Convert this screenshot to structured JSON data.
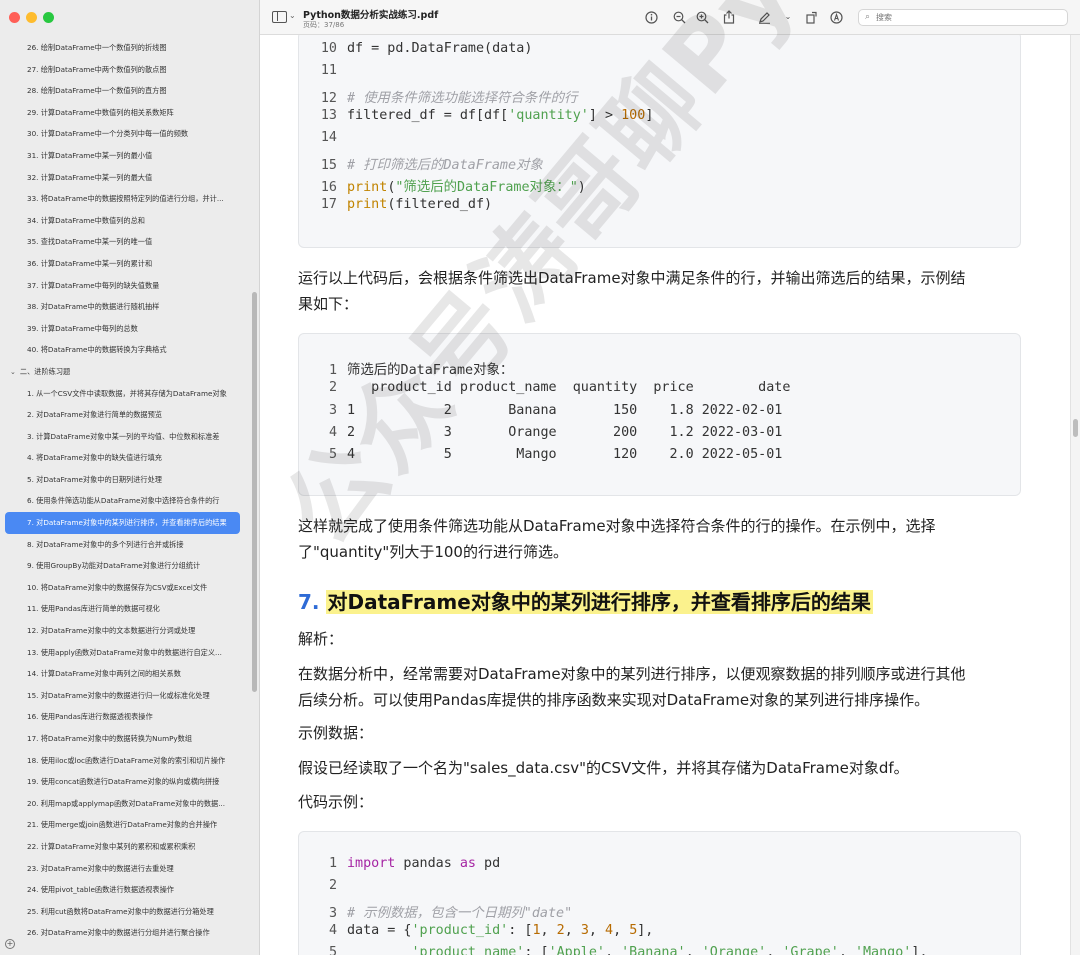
{
  "window": {
    "traffic_colors": [
      "#ff5f57",
      "#febc2e",
      "#28c840"
    ]
  },
  "toolbar": {
    "title": "Python数据分析实战练习.pdf",
    "page_info": "页码：37/86",
    "search_placeholder": "搜索",
    "icons": [
      "info-icon",
      "zoom-out-icon",
      "zoom-in-icon",
      "share-icon",
      "markup-pen-icon",
      "chevron-down-icon",
      "rotate-icon",
      "annotate-icon"
    ]
  },
  "sidebar": {
    "items": [
      {
        "label": "26. 绘制DataFrame中一个数值列的折线图",
        "type": "item"
      },
      {
        "label": "27. 绘制DataFrame中两个数值列的散点图",
        "type": "item"
      },
      {
        "label": "28. 绘制DataFrame中一个数值列的直方图",
        "type": "item"
      },
      {
        "label": "29. 计算DataFrame中数值列的相关系数矩阵",
        "type": "item"
      },
      {
        "label": "30. 计算DataFrame中一个分类列中每一值的频数",
        "type": "item"
      },
      {
        "label": "31. 计算DataFrame中某一列的最小值",
        "type": "item"
      },
      {
        "label": "32. 计算DataFrame中某一列的最大值",
        "type": "item"
      },
      {
        "label": "33. 将DataFrame中的数据按照特定列的值进行分组，并计...",
        "type": "item"
      },
      {
        "label": "34. 计算DataFrame中数值列的总和",
        "type": "item"
      },
      {
        "label": "35. 查找DataFrame中某一列的唯一值",
        "type": "item"
      },
      {
        "label": "36. 计算DataFrame中某一列的累计和",
        "type": "item"
      },
      {
        "label": "37. 计算DataFrame中每列的缺失值数量",
        "type": "item"
      },
      {
        "label": "38. 对DataFrame中的数据进行随机抽样",
        "type": "item"
      },
      {
        "label": "39. 计算DataFrame中每列的总数",
        "type": "item"
      },
      {
        "label": "40. 将DataFrame中的数据转换为字典格式",
        "type": "item"
      },
      {
        "label": "二、进阶练习题",
        "type": "section"
      },
      {
        "label": "1. 从一个CSV文件中读取数据，并将其存储为DataFrame对象",
        "type": "item"
      },
      {
        "label": "2. 对DataFrame对象进行简单的数据预览",
        "type": "item"
      },
      {
        "label": "3. 计算DataFrame对象中某一列的平均值、中位数和标准差",
        "type": "item"
      },
      {
        "label": "4. 将DataFrame对象中的缺失值进行填充",
        "type": "item"
      },
      {
        "label": "5. 对DataFrame对象中的日期列进行处理",
        "type": "item"
      },
      {
        "label": "6. 使用条件筛选功能从DataFrame对象中选择符合条件的行",
        "type": "item"
      },
      {
        "label": "7. 对DataFrame对象中的某列进行排序，并查看排序后的结果",
        "type": "active"
      },
      {
        "label": "8. 对DataFrame对象中的多个列进行合并或拆接",
        "type": "item"
      },
      {
        "label": "9. 使用GroupBy功能对DataFrame对象进行分组统计",
        "type": "item"
      },
      {
        "label": "10. 将DataFrame对象中的数据保存为CSV或Excel文件",
        "type": "item"
      },
      {
        "label": "11. 使用Pandas库进行简单的数据可视化",
        "type": "item"
      },
      {
        "label": "12. 对DataFrame对象中的文本数据进行分词或处理",
        "type": "item"
      },
      {
        "label": "13. 使用apply函数对DataFrame对象中的数据进行自定义...",
        "type": "item"
      },
      {
        "label": "14. 计算DataFrame对象中两列之间的相关系数",
        "type": "item"
      },
      {
        "label": "15. 对DataFrame对象中的数据进行归一化或标准化处理",
        "type": "item"
      },
      {
        "label": "16. 使用Pandas库进行数据透视表操作",
        "type": "item"
      },
      {
        "label": "17. 将DataFrame对象中的数据转换为NumPy数组",
        "type": "item"
      },
      {
        "label": "18. 使用iloc或loc函数进行DataFrame对象的索引和切片操作",
        "type": "item"
      },
      {
        "label": "19. 使用concat函数进行DataFrame对象的纵向或横向拼接",
        "type": "item"
      },
      {
        "label": "20. 利用map或applymap函数对DataFrame对象中的数据...",
        "type": "item"
      },
      {
        "label": "21. 使用merge或join函数进行DataFrame对象的合并操作",
        "type": "item"
      },
      {
        "label": "22. 计算DataFrame对象中某列的累积和或累积乘积",
        "type": "item"
      },
      {
        "label": "23. 对DataFrame对象中的数据进行去重处理",
        "type": "item"
      },
      {
        "label": "24. 使用pivot_table函数进行数据透视表操作",
        "type": "item"
      },
      {
        "label": "25. 利用cut函数将DataFrame对象中的数据进行分箱处理",
        "type": "item"
      },
      {
        "label": "26. 对DataFrame对象中的数据进行分组并进行聚合操作",
        "type": "item"
      }
    ]
  },
  "doc": {
    "code1": [
      {
        "n": "10",
        "html": "df = pd.DataFrame(data)"
      },
      {
        "n": "11",
        "html": ""
      },
      {
        "n": "12",
        "html": "<span class=\"com\"># 使用条件筛选功能选择符合条件的行</span>"
      },
      {
        "n": "13",
        "html": "filtered_df = df[df[<span class=\"str\">'quantity'</span>] &gt; <span class=\"num\">100</span>]"
      },
      {
        "n": "14",
        "html": ""
      },
      {
        "n": "15",
        "html": "<span class=\"com\"># 打印筛选后的DataFrame对象</span>"
      },
      {
        "n": "16",
        "html": "<span class=\"fn\">print</span>(<span class=\"str\">\"筛选后的DataFrame对象：\"</span>)"
      },
      {
        "n": "17",
        "html": "<span class=\"fn\">print</span>(filtered_df)"
      }
    ],
    "para1": [
      "运行以上代码后，会根据条件筛选出DataFrame对象中满足条件的行，并输出筛选后的结果，示例结",
      "果如下："
    ],
    "output": [
      {
        "n": "1",
        "html": "筛选后的DataFrame对象："
      },
      {
        "n": "2",
        "html": "   product_id product_name  quantity  price        date"
      },
      {
        "n": "3",
        "html": "1           2       Banana       150    1.8 2022-02-01"
      },
      {
        "n": "4",
        "html": "2           3       Orange       200    1.2 2022-03-01"
      },
      {
        "n": "5",
        "html": "4           5        Mango       120    2.0 2022-05-01"
      }
    ],
    "para2": [
      "这样就完成了使用条件筛选功能从DataFrame对象中选择符合条件的行的操作。在示例中，选择",
      "了\"quantity\"列大于100的行进行筛选。"
    ],
    "heading_num": "7.",
    "heading_text": "对DataFrame对象中的某列进行排序，并查看排序后的结果",
    "label_analysis": "解析：",
    "para3": [
      "在数据分析中，经常需要对DataFrame对象中的某列进行排序，以便观察数据的排列顺序或进行其他",
      "后续分析。可以使用Pandas库提供的排序函数来实现对DataFrame对象的某列进行排序操作。"
    ],
    "label_sample": "示例数据：",
    "para4": "假设已经读取了一个名为\"sales_data.csv\"的CSV文件，并将其存储为DataFrame对象df。",
    "label_code": "代码示例：",
    "code2": [
      {
        "n": "1",
        "html": "<span class=\"kw\">import</span> pandas <span class=\"kw\">as</span> pd"
      },
      {
        "n": "2",
        "html": ""
      },
      {
        "n": "3",
        "html": "<span class=\"com\"># 示例数据，包含一个日期列\"date\"</span>"
      },
      {
        "n": "4",
        "html": "data = {<span class=\"str\">'product_id'</span>: [<span class=\"num\">1</span>, <span class=\"num\">2</span>, <span class=\"num\">3</span>, <span class=\"num\">4</span>, <span class=\"num\">5</span>],"
      },
      {
        "n": "5",
        "html": "        <span class=\"str\">'product_name'</span>: [<span class=\"str\">'Apple'</span>, <span class=\"str\">'Banana'</span>, <span class=\"str\">'Orange'</span>, <span class=\"str\">'Grape'</span>, <span class=\"str\">'Mango'</span>],"
      }
    ],
    "watermark": "公众号涛哥聊Python"
  }
}
